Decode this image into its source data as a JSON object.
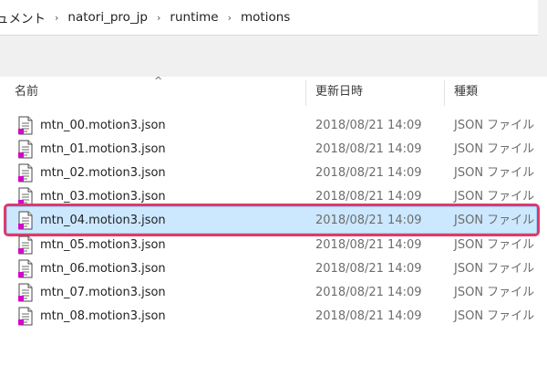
{
  "breadcrumb": {
    "items": [
      "ュメント",
      "natori_pro_jp",
      "runtime",
      "motions"
    ],
    "separator": "›"
  },
  "header": {
    "name": "名前",
    "date": "更新日時",
    "type": "種類",
    "sort_indicator": "^"
  },
  "files": [
    {
      "name": "mtn_00.motion3.json",
      "date": "2018/08/21 14:09",
      "type": "JSON ファイル"
    },
    {
      "name": "mtn_01.motion3.json",
      "date": "2018/08/21 14:09",
      "type": "JSON ファイル"
    },
    {
      "name": "mtn_02.motion3.json",
      "date": "2018/08/21 14:09",
      "type": "JSON ファイル"
    },
    {
      "name": "mtn_03.motion3.json",
      "date": "2018/08/21 14:09",
      "type": "JSON ファイル"
    },
    {
      "name": "mtn_04.motion3.json",
      "date": "2018/08/21 14:09",
      "type": "JSON ファイル",
      "selected": true
    },
    {
      "name": "mtn_05.motion3.json",
      "date": "2018/08/21 14:09",
      "type": "JSON ファイル"
    },
    {
      "name": "mtn_06.motion3.json",
      "date": "2018/08/21 14:09",
      "type": "JSON ファイル"
    },
    {
      "name": "mtn_07.motion3.json",
      "date": "2018/08/21 14:09",
      "type": "JSON ファイル"
    },
    {
      "name": "mtn_08.motion3.json",
      "date": "2018/08/21 14:09",
      "type": "JSON ファイル"
    }
  ],
  "colors": {
    "selection_fill": "#cce8ff",
    "selection_border": "#99d1ff",
    "highlight_annotation": "#e0396a"
  }
}
